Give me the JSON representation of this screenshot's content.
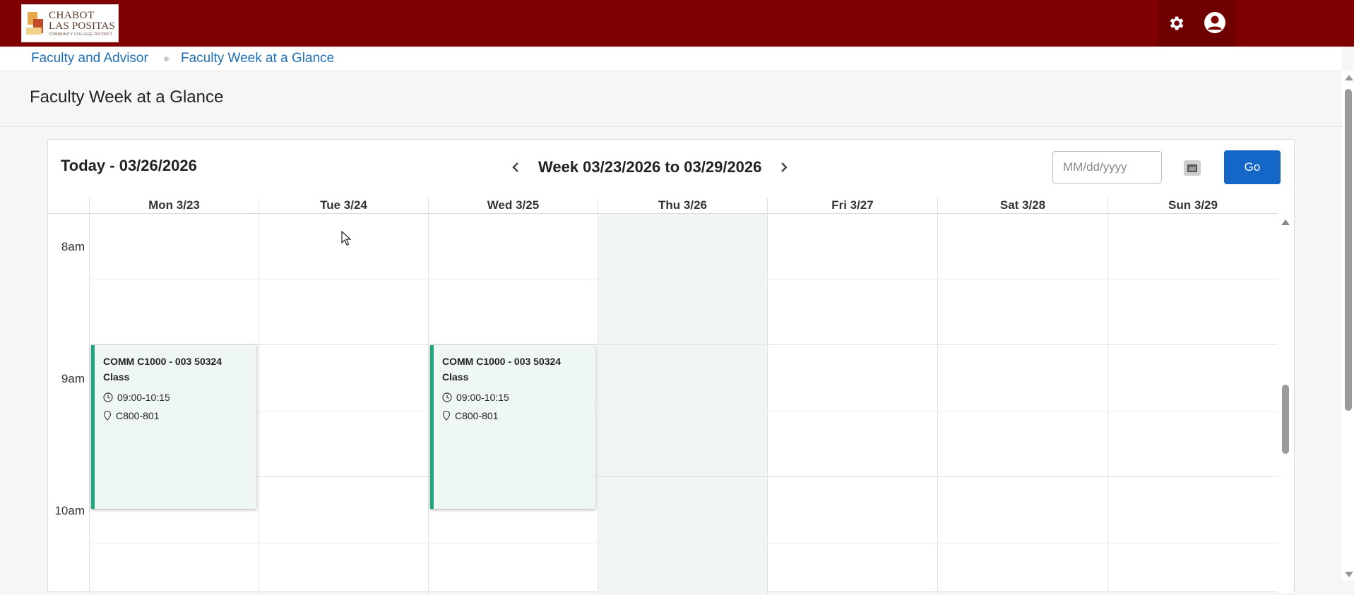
{
  "header": {
    "logo": {
      "line1": "CHABOT",
      "line2": "LAS POSITAS",
      "line3": "COMMUNITY COLLEGE DISTRICT"
    },
    "icons": [
      "gear-icon",
      "user-icon"
    ],
    "colors": {
      "bar": "#7f0000",
      "link": "#1f6fb6",
      "accent": "#1466c7",
      "event_border": "#1ea77e"
    }
  },
  "breadcrumb": {
    "items": [
      "Faculty and Advisor",
      "Faculty Week at a Glance"
    ]
  },
  "page": {
    "title": "Faculty Week at a Glance"
  },
  "calendar": {
    "today_label": "Today - 03/26/2026",
    "week_label": "Week 03/23/2026 to 03/29/2026",
    "date_placeholder": "MM/dd/yyyy",
    "go_label": "Go",
    "days": [
      "Mon 3/23",
      "Tue 3/24",
      "Wed 3/25",
      "Thu 3/26",
      "Fri 3/27",
      "Sat 3/28",
      "Sun 3/29"
    ],
    "highlighted_day": "Thu 3/26",
    "times": [
      "8am",
      "9am",
      "10am"
    ],
    "events": [
      {
        "day": "Mon 3/23",
        "title": "COMM C1000 - 003 50324",
        "type": "Class",
        "time": "09:00-10:15",
        "location": "C800-801"
      },
      {
        "day": "Wed 3/25",
        "title": "COMM C1000 - 003 50324",
        "type": "Class",
        "time": "09:00-10:15",
        "location": "C800-801"
      }
    ]
  }
}
